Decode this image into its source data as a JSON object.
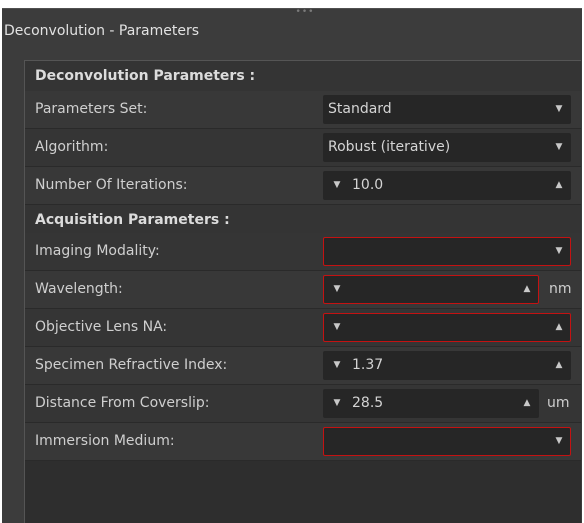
{
  "window": {
    "title": "Deconvolution - Parameters"
  },
  "sections": {
    "deconvolution": "Deconvolution Parameters :",
    "acquisition": "Acquisition Parameters :"
  },
  "fields": {
    "parameters_set": {
      "label": "Parameters Set:",
      "value": "Standard"
    },
    "algorithm": {
      "label": "Algorithm:",
      "value": "Robust (iterative)"
    },
    "iterations": {
      "label": "Number Of Iterations:",
      "value": "10.0"
    },
    "imaging_modality": {
      "label": "Imaging Modality:",
      "value": ""
    },
    "wavelength": {
      "label": "Wavelength:",
      "value": "",
      "unit": "nm"
    },
    "objective_na": {
      "label": "Objective Lens NA:",
      "value": ""
    },
    "specimen_ri": {
      "label": "Specimen Refractive Index:",
      "value": "1.37"
    },
    "distance_coverslip": {
      "label": "Distance From Coverslip:",
      "value": "28.5",
      "unit": "um"
    },
    "immersion_medium": {
      "label": "Immersion Medium:",
      "value": ""
    }
  },
  "colors": {
    "window_bg": "#3c3c3c",
    "panel_bg": "#2e2e2e",
    "field_bg": "#262626",
    "error_border": "#c41212"
  }
}
